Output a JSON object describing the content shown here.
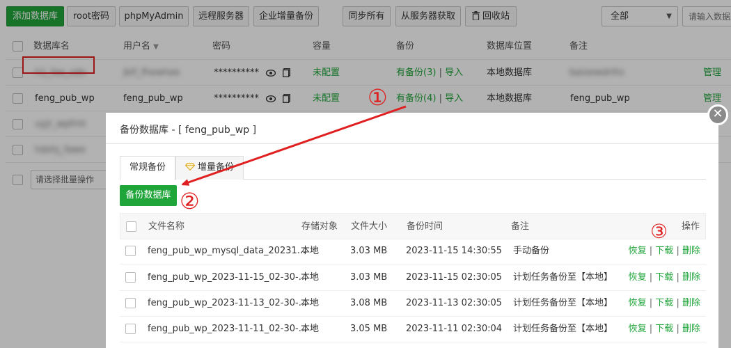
{
  "toolbar": {
    "add_db": "添加数据库",
    "root_pwd": "root密码",
    "phpmyadmin": "phpMyAdmin",
    "remote_server": "远程服务器",
    "incremental_backup": "企业增量备份",
    "sync_all": "同步所有",
    "fetch_from_server": "从服务器获取",
    "recycle_bin": "回收站",
    "filter_selected": "全部",
    "search_placeholder": "请输入数据库名"
  },
  "db_table": {
    "headers": {
      "name": "数据库名",
      "user": "用户名",
      "password": "密码",
      "capacity": "容量",
      "backup": "备份",
      "location": "数据库位置",
      "remark": "备注"
    },
    "rows": [
      {
        "name": "h1_fae_sde",
        "user": "jklf_fhewhee",
        "password": "**********",
        "capacity": "未配置",
        "backup": "有备份(3)",
        "import": "导入",
        "location": "本地数据库",
        "remark": "baioewdrihs",
        "manage": "管理",
        "blurred": true
      },
      {
        "name": "feng_pub_wp",
        "user": "feng_pub_wp",
        "password": "**********",
        "capacity": "未配置",
        "backup": "有备份(4)",
        "import": "导入",
        "location": "本地数据库",
        "remark": "feng_pub_wp",
        "manage": "管理",
        "blurred": false
      },
      {
        "name": "uyjr_wpfrnt",
        "blurred": true
      },
      {
        "name": "hdshj_fawe",
        "blurred": true
      }
    ],
    "batch_placeholder": "请选择批量操作"
  },
  "modal": {
    "title": "备份数据库 - [ feng_pub_wp ]",
    "tabs": [
      "常规备份",
      "增量备份"
    ],
    "backup_button": "备份数据库",
    "table": {
      "headers": {
        "filename": "文件名称",
        "storage": "存储对象",
        "size": "文件大小",
        "time": "备份时间",
        "remark": "备注",
        "ops": "操作"
      },
      "rows": [
        {
          "filename": "feng_pub_wp_mysql_data_20231...",
          "storage": "本地",
          "size": "3.03 MB",
          "time": "2023-11-15 14:30:55",
          "remark": "手动备份"
        },
        {
          "filename": "feng_pub_wp_2023-11-15_02-30-...",
          "storage": "本地",
          "size": "3.03 MB",
          "time": "2023-11-15 02:30:05",
          "remark": "计划任务备份至【本地】"
        },
        {
          "filename": "feng_pub_wp_2023-11-13_02-30-...",
          "storage": "本地",
          "size": "3.08 MB",
          "time": "2023-11-13 02:30:05",
          "remark": "计划任务备份至【本地】"
        },
        {
          "filename": "feng_pub_wp_2023-11-11_02-30-...",
          "storage": "本地",
          "size": "3.05 MB",
          "time": "2023-11-11 02:30:04",
          "remark": "计划任务备份至【本地】"
        }
      ],
      "op_restore": "恢复",
      "op_download": "下载",
      "op_delete": "删除",
      "op_sep": "|"
    }
  },
  "annotations": {
    "one": "①",
    "two": "②",
    "three": "③"
  },
  "colors": {
    "brand_green": "#20a53a",
    "annotation_red": "#e02020"
  }
}
